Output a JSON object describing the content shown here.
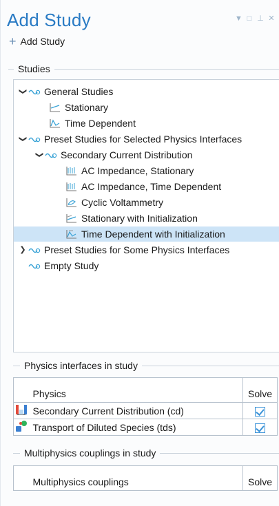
{
  "header": {
    "title": "Add Study",
    "add_label": "Add Study",
    "window_controls": [
      "dropdown-icon",
      "restore-icon",
      "pin-icon",
      "close-icon"
    ]
  },
  "studies": {
    "section_label": "Studies",
    "nodes": {
      "general": "General Studies",
      "stationary": "Stationary",
      "time_dependent": "Time Dependent",
      "preset_selected": "Preset Studies for Selected Physics Interfaces",
      "secondary": "Secondary Current Distribution",
      "ac_stationary": "AC Impedance, Stationary",
      "ac_time": "AC Impedance, Time Dependent",
      "cyclic": "Cyclic Voltammetry",
      "stat_init": "Stationary with Initialization",
      "time_init": "Time Dependent with Initialization",
      "preset_some": "Preset Studies for Some Physics Interfaces",
      "empty": "Empty Study"
    },
    "selected": "time_init"
  },
  "physics": {
    "section_label": "Physics interfaces in study",
    "col_physics": "Physics",
    "col_solve": "Solve",
    "rows": [
      {
        "name": "Secondary Current Distribution (cd)",
        "solve": true
      },
      {
        "name": "Transport of Diluted Species (tds)",
        "solve": true
      }
    ]
  },
  "multiphysics": {
    "section_label": "Multiphysics couplings in study",
    "col_name": "Multiphysics couplings",
    "col_solve": "Solve"
  },
  "colors": {
    "accent": "#2a7bc4",
    "selection": "#cde4f7",
    "check": "#3b93d8"
  }
}
